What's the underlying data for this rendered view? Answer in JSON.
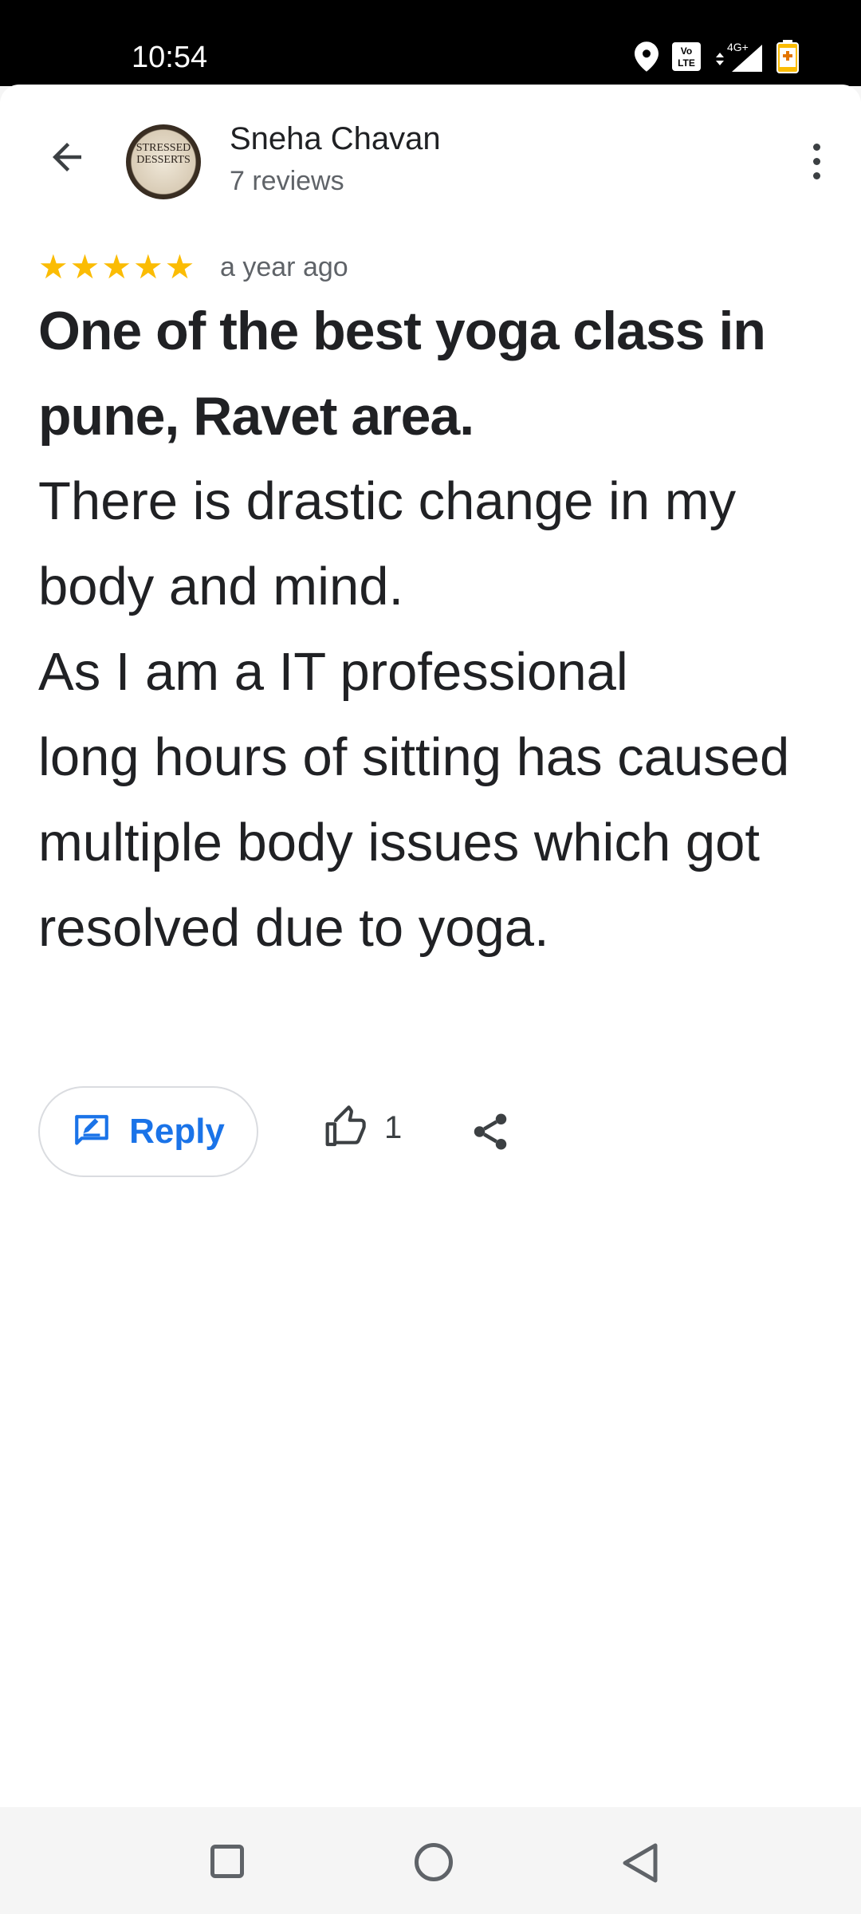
{
  "status_bar": {
    "time": "10:54",
    "icons": [
      "location-icon",
      "volte-icon",
      "4g-signal-icon",
      "battery-saver-icon"
    ],
    "network_label": "4G+",
    "volte_label": "Vo LTE"
  },
  "header": {
    "back_icon": "arrow-back-icon",
    "avatar_text": "STRESSED DESSERTS",
    "reviewer_name": "Sneha Chavan",
    "review_count": "7 reviews",
    "more_icon": "more-vert-icon"
  },
  "review": {
    "rating": 5,
    "stars": [
      "★",
      "★",
      "★",
      "★",
      "★"
    ],
    "time": "a year ago",
    "title": "One of the best yoga class in pune, Ravet area.",
    "body": "There is drastic change in my body and mind.\nAs I am a IT professional\nlong hours of sitting has caused multiple body issues which got resolved due to yoga."
  },
  "actions": {
    "reply_label": "Reply",
    "like_count": "1",
    "icons": [
      "reply-edit-icon",
      "thumb-up-icon",
      "share-icon"
    ]
  },
  "colors": {
    "accent": "#1a73e8",
    "star": "#fbbc04",
    "text_primary": "#202124",
    "text_secondary": "#5f6368"
  }
}
